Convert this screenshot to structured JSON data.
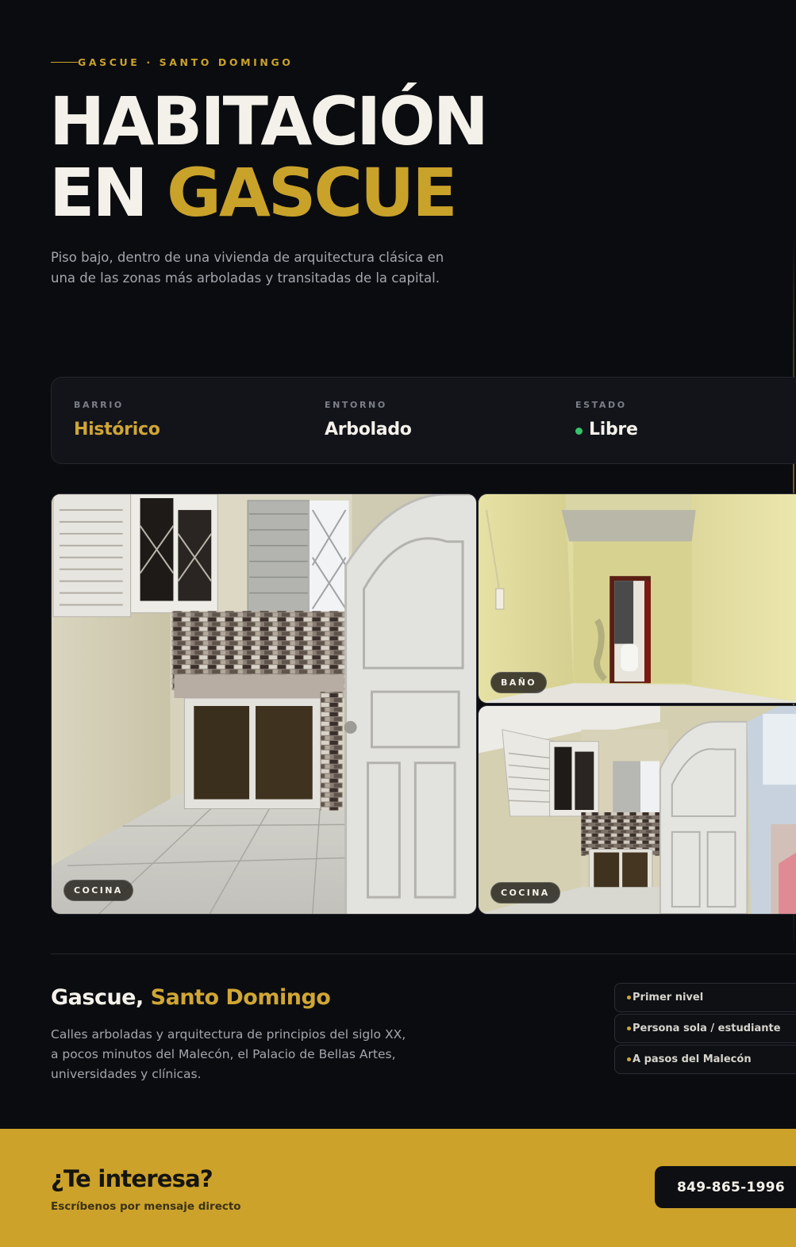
{
  "hero": {
    "eyebrow": "GASCUE · SANTO DOMINGO",
    "title_line1": "HABITACIÓN",
    "title_line2_prefix": "EN",
    "title_line2_accent": "GASCUE",
    "description": "Piso bajo, dentro de una vivienda de arquitectura clásica en una de las zonas más arboladas y transitadas de la capital."
  },
  "stats": [
    {
      "key": "BARRIO",
      "value": "Histórico"
    },
    {
      "key": "ENTORNO",
      "value": "Arbolado"
    },
    {
      "key": "ESTADO",
      "value": "Libre",
      "status_color": "#36c46a"
    }
  ],
  "gallery": {
    "main_tag": "COCINA",
    "top_tag": "BAÑO",
    "bottom_tag": "COCINA"
  },
  "location": {
    "title_prefix": "Gascue,",
    "title_accent": "Santo Domingo",
    "description": "Calles arboladas y arquitectura de principios del siglo XX, a pocos minutos del Malecón, el Palacio de Bellas Artes, universidades y clínicas.",
    "features": [
      "Primer nivel",
      "Persona sola / estudiante",
      "A pasos del Malecón"
    ]
  },
  "cta": {
    "title": "¿Te interesa?",
    "subtitle": "Escríbenos por mensaje directo",
    "phone": "849-865-1996"
  },
  "colors": {
    "background": "#0b0c0f",
    "accent": "#c9a22a",
    "cta_background": "#cca22a"
  }
}
